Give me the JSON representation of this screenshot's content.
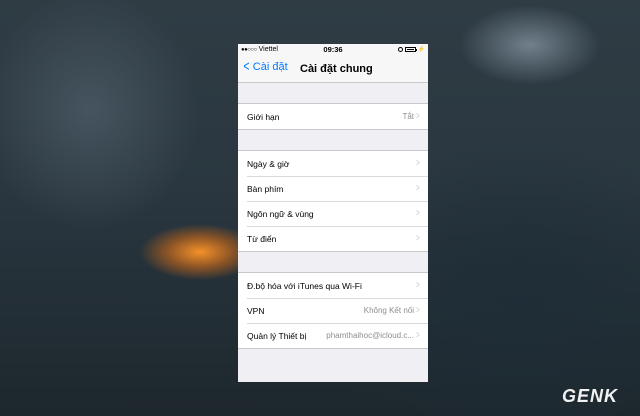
{
  "status_bar": {
    "carrier": "Viettel",
    "time": "09:36"
  },
  "nav": {
    "back_label": "Cài đặt",
    "title": "Cài đặt chung"
  },
  "groups": [
    {
      "rows": [
        {
          "label": "Giới hạn",
          "value": "Tắt"
        }
      ]
    },
    {
      "rows": [
        {
          "label": "Ngày & giờ",
          "value": ""
        },
        {
          "label": "Bàn phím",
          "value": ""
        },
        {
          "label": "Ngôn ngữ & vùng",
          "value": ""
        },
        {
          "label": "Từ điển",
          "value": ""
        }
      ]
    },
    {
      "rows": [
        {
          "label": "Đ.bộ hóa với iTunes qua Wi-Fi",
          "value": ""
        },
        {
          "label": "VPN",
          "value": "Không Kết nối"
        },
        {
          "label": "Quản lý Thiết bị",
          "value": "phamthaihoc@icloud.c..."
        }
      ]
    }
  ],
  "watermark": "GENK"
}
